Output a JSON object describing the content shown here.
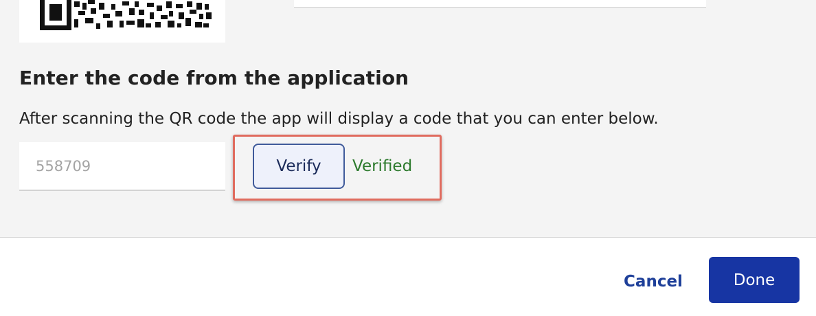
{
  "setup": {
    "qr_code_icon": "qr-code-image",
    "heading": "Enter the code from the application",
    "description": "After scanning the QR code the app will display a code that you can enter below.",
    "code_input": {
      "value": "",
      "placeholder": "558709"
    },
    "verify_label": "Verify",
    "status_text": "Verified",
    "status_color": "#2d7a2d",
    "highlight_color": "#e06b5e"
  },
  "footer": {
    "cancel_label": "Cancel",
    "done_label": "Done",
    "accent_color": "#1735a3"
  }
}
